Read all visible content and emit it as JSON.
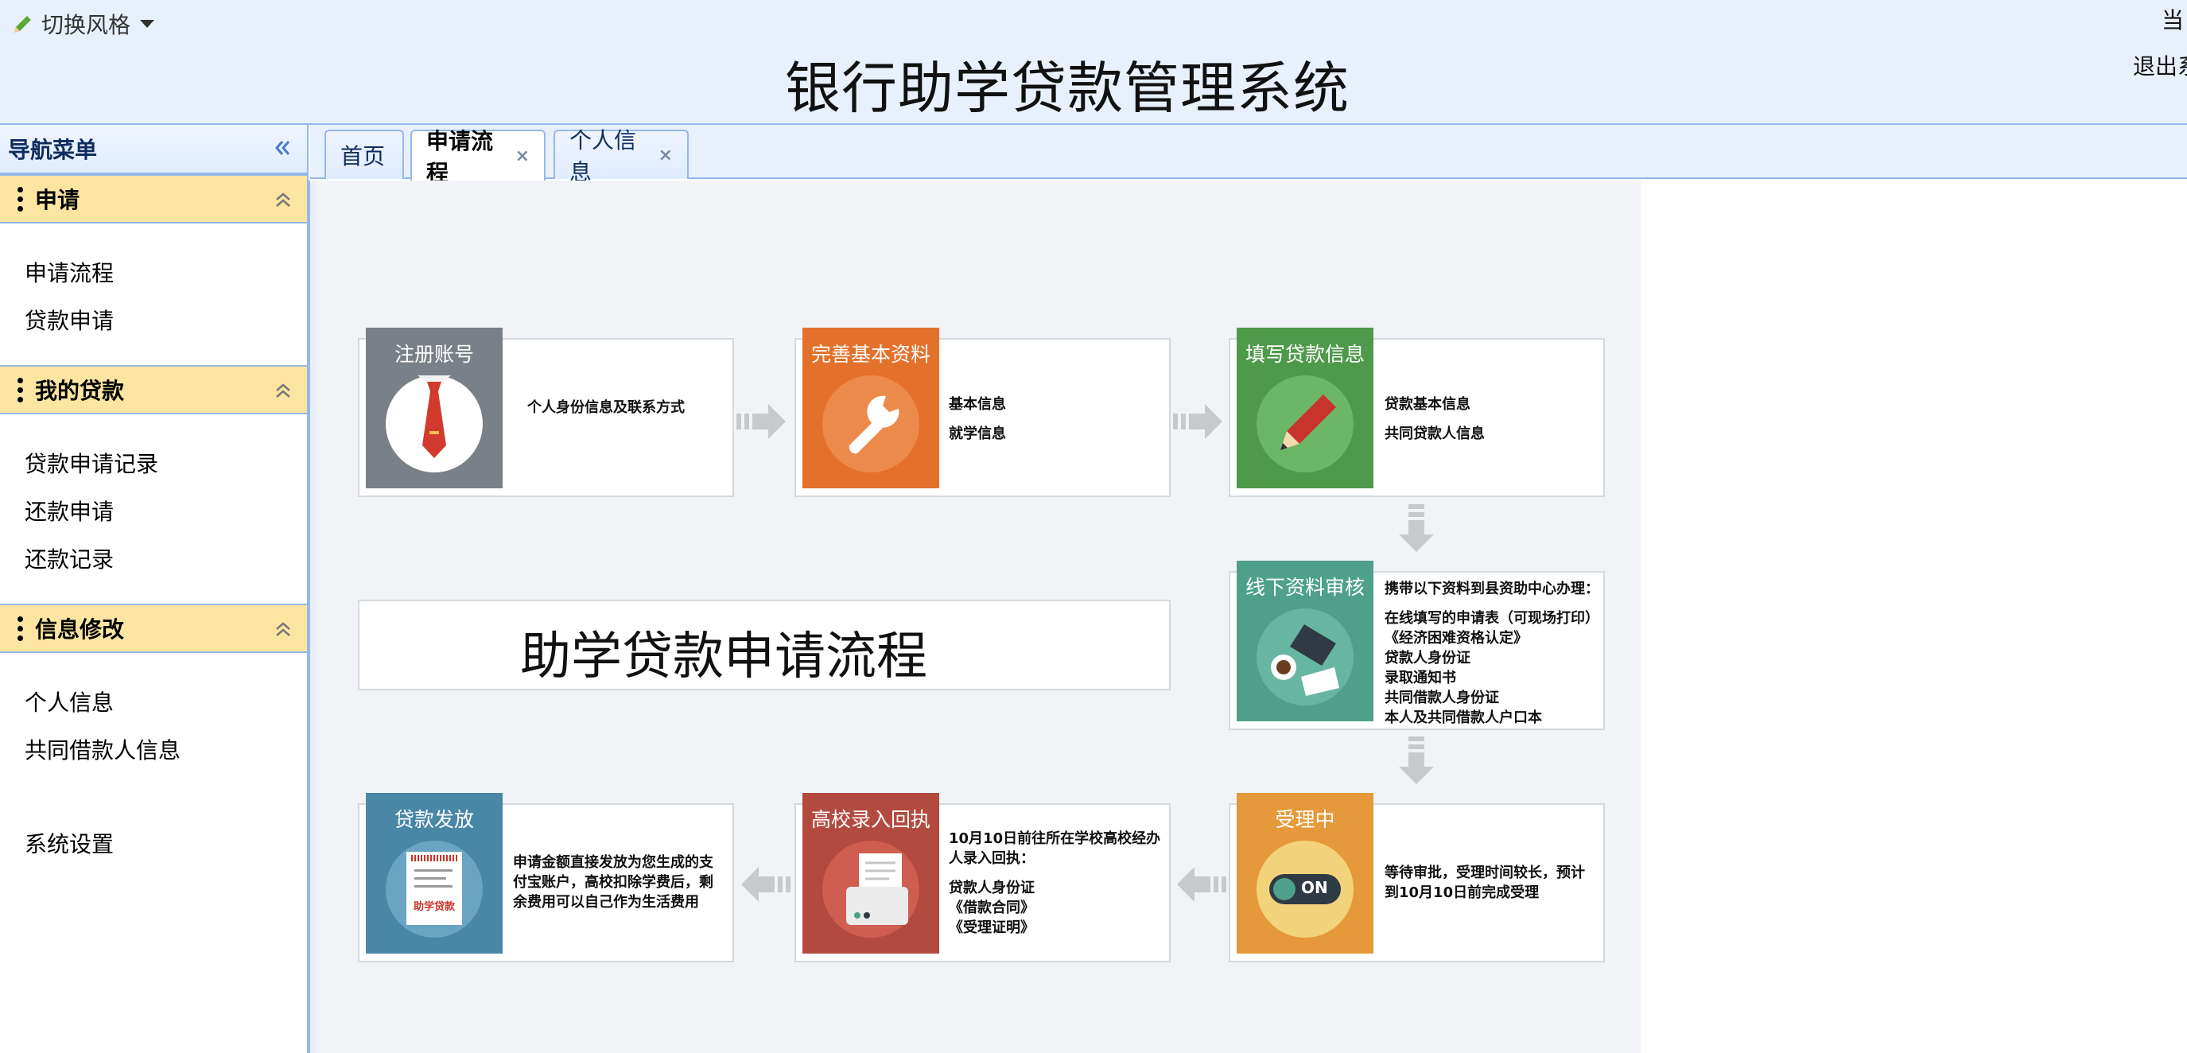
{
  "header": {
    "style_switch_label": "切换风格",
    "system_title": "银行助学贷款管理系统",
    "current_user_label": "当",
    "logout_label": "退出系"
  },
  "sidebar": {
    "nav_title": "导航菜单",
    "groups": [
      {
        "title": "申请",
        "items": [
          "申请流程",
          "贷款申请"
        ]
      },
      {
        "title": "我的贷款",
        "items": [
          "贷款申请记录",
          "还款申请",
          "还款记录"
        ]
      },
      {
        "title": "信息修改",
        "items": [
          "个人信息",
          "共同借款人信息"
        ]
      }
    ],
    "settings_label": "系统设置"
  },
  "tabs": [
    {
      "label": "首页",
      "closable": false
    },
    {
      "label": "申请流程",
      "closable": true,
      "active": true
    },
    {
      "label": "个人信息",
      "closable": true
    }
  ],
  "tab_close_glyph": "×",
  "flow": {
    "banner": "助学贷款申请流程",
    "steps": [
      {
        "title": "注册账号",
        "lines": [
          "个人身份信息及联系方式"
        ],
        "color": "#7a8087",
        "icon": "tie-icon"
      },
      {
        "title": "完善基本资料",
        "lines": [
          "基本信息",
          "就学信息"
        ],
        "color": "#e3712b",
        "icon": "wrench-icon"
      },
      {
        "title": "填写贷款信息",
        "lines": [
          "贷款基本信息",
          "共同贷款人信息"
        ],
        "color": "#4e9a4a",
        "icon": "pencil-icon"
      },
      {
        "title": "线下资料审核",
        "lines": [
          "携带以下资料到县资助中心办理：",
          "在线填写的申请表（可现场打印）",
          "《经济困难资格认定》",
          "贷款人身份证",
          "录取通知书",
          "共同借款人身份证",
          "本人及共同借款人户口本"
        ],
        "color": "#4fa08b",
        "icon": "coffee-keyboard-icon"
      },
      {
        "title": "受理中",
        "lines": [
          "等待审批，受理时间较长，预计",
          "到10月10日前完成受理"
        ],
        "color": "#e5993a",
        "icon": "toggle-on-icon",
        "toggle_text": "ON"
      },
      {
        "title": "高校录入回执",
        "lines": [
          "10月10日前往所在学校高校经办",
          "人录入回执：",
          "贷款人身份证",
          "《借款合同》",
          "《受理证明》"
        ],
        "color": "#b34a3f",
        "icon": "printer-icon"
      },
      {
        "title": "贷款发放",
        "lines": [
          "申请金额直接发放为您生成的支",
          "付宝账户，高校扣除学费后，剩",
          "余费用可以自己作为生活费用"
        ],
        "color": "#4a86a6",
        "icon": "receipt-icon",
        "receipt_text": "助学贷款"
      }
    ]
  },
  "colors": {
    "header_bg": "#e8f1fb",
    "border": "#95b8e7",
    "group_bg": "#fbe5a0"
  }
}
